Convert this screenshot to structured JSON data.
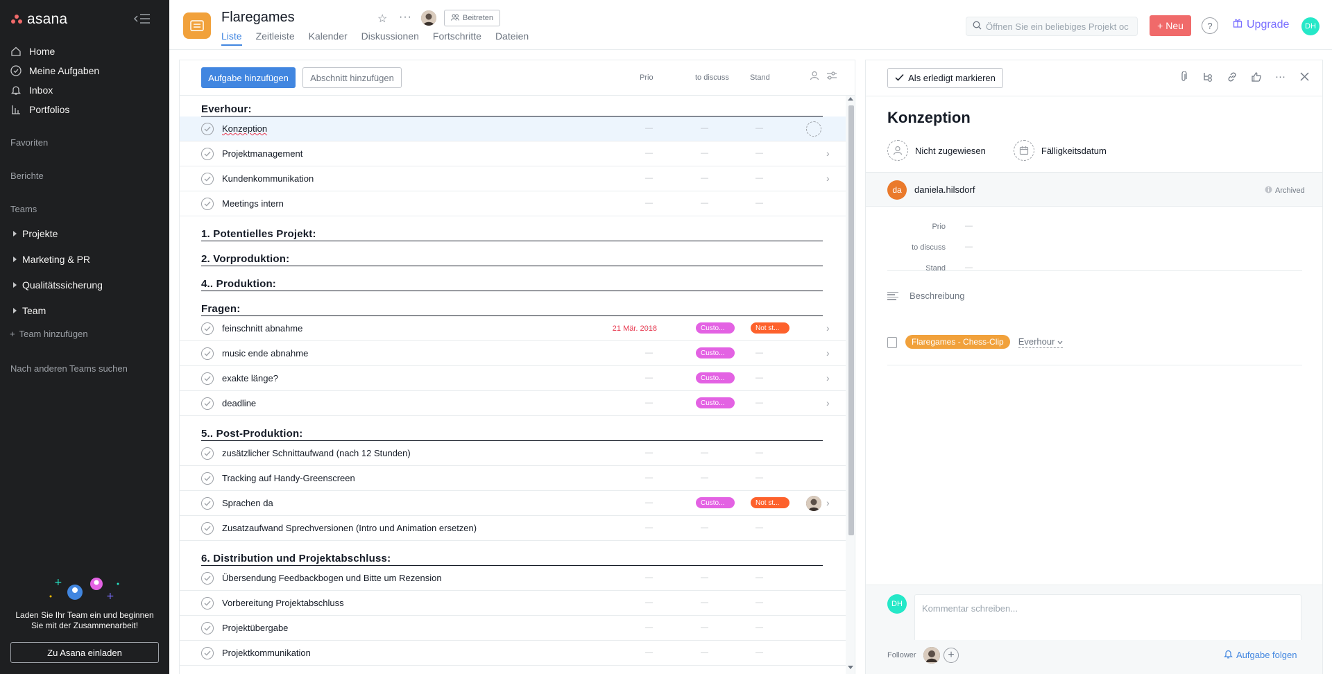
{
  "sidebar": {
    "brand": "asana",
    "nav": [
      {
        "label": "Home",
        "icon": "home-icon"
      },
      {
        "label": "Meine Aufgaben",
        "icon": "check-circle-icon"
      },
      {
        "label": "Inbox",
        "icon": "bell-icon"
      },
      {
        "label": "Portfolios",
        "icon": "bar-chart-icon"
      }
    ],
    "favorites_label": "Favoriten",
    "reports_label": "Berichte",
    "teams_label": "Teams",
    "teams": [
      "Projekte",
      "Marketing & PR",
      "Qualitätssicherung",
      "Team"
    ],
    "add_team": "Team hinzufügen",
    "browse_teams": "Nach anderen Teams suchen",
    "invite_text": "Laden Sie Ihr Team ein und beginnen Sie mit der Zusammenarbeit!",
    "invite_button": "Zu Asana einladen"
  },
  "header": {
    "project_title": "Flaregames",
    "join_button": "Beitreten",
    "tabs": [
      "Liste",
      "Zeitleiste",
      "Kalender",
      "Diskussionen",
      "Fortschritte",
      "Dateien"
    ],
    "active_tab": "Liste",
    "search_placeholder": "Öffnen Sie ein beliebiges Projekt oc",
    "new_button": "Neu",
    "help": "?",
    "upgrade": "Upgrade",
    "user_initials": "DH"
  },
  "list": {
    "add_task_button": "Aufgabe hinzufügen",
    "add_section_button": "Abschnitt hinzufügen",
    "columns": [
      "Prio",
      "to discuss",
      "Stand"
    ],
    "empty": "—",
    "rows": [
      {
        "type": "section",
        "title": "Everhour:"
      },
      {
        "type": "task",
        "name": "Konzeption",
        "highlight": true,
        "assign": true
      },
      {
        "type": "task",
        "name": "Projektmanagement",
        "chevron": true
      },
      {
        "type": "task",
        "name": "Kundenkommunikation",
        "chevron": true
      },
      {
        "type": "task",
        "name": "Meetings intern"
      },
      {
        "type": "section",
        "title": "1. Potentielles Projekt:"
      },
      {
        "type": "section",
        "title": "2. Vorproduktion:"
      },
      {
        "type": "section",
        "title": "4.. Produktion:"
      },
      {
        "type": "section",
        "title": "Fragen:"
      },
      {
        "type": "task",
        "name": "feinschnitt abnahme",
        "due": "21 Mär. 2018",
        "discuss": "Custo...",
        "stand": "Not st...",
        "chevron": true
      },
      {
        "type": "task",
        "name": "music ende abnahme",
        "discuss": "Custo...",
        "chevron": true
      },
      {
        "type": "task",
        "name": "exakte länge?",
        "discuss": "Custo...",
        "chevron": true
      },
      {
        "type": "task",
        "name": "deadline",
        "discuss": "Custo...",
        "chevron": true
      },
      {
        "type": "section",
        "title": "5.. Post-Produktion:"
      },
      {
        "type": "task",
        "name": "zusätzlicher Schnittaufwand (nach 12 Stunden)"
      },
      {
        "type": "task",
        "name": "Tracking auf Handy-Greenscreen"
      },
      {
        "type": "task",
        "name": "Sprachen da",
        "discuss": "Custo...",
        "stand": "Not st...",
        "avatar": true,
        "chevron": true
      },
      {
        "type": "task",
        "name": "Zusatzaufwand Sprechversionen (Intro und Animation ersetzen)"
      },
      {
        "type": "section",
        "title": "6. Distribution und Projektabschluss:"
      },
      {
        "type": "task",
        "name": "Übersendung Feedbackbogen und Bitte um Rezension"
      },
      {
        "type": "task",
        "name": "Vorbereitung Projektabschluss"
      },
      {
        "type": "task",
        "name": "Projektübergabe"
      },
      {
        "type": "task",
        "name": "Projektkommunikation"
      }
    ]
  },
  "detail": {
    "mark_done": "Als erledigt markieren",
    "title": "Konzeption",
    "assignee": "Nicht zugewiesen",
    "due_date": "Fälligkeitsdatum",
    "user_initials": "da",
    "user_name": "daniela.hilsdorf",
    "archived": "Archived",
    "fields": [
      {
        "label": "Prio",
        "value": "—"
      },
      {
        "label": "to discuss",
        "value": "—"
      },
      {
        "label": "Stand",
        "value": "—"
      }
    ],
    "description_placeholder": "Beschreibung",
    "project_tag": "Flaregames - Chess-Clip",
    "section": "Everhour",
    "comment_initials": "DH",
    "comment_placeholder": "Kommentar schreiben...",
    "follower_label": "Follower",
    "follow_button": "Aufgabe folgen"
  },
  "colors": {
    "sidebar_bg": "#1e1f21",
    "primary_blue": "#4186e0",
    "new_button": "#f06a6a",
    "project_orange": "#f1a13b",
    "pill_custom": "#e362e3",
    "pill_notstarted": "#fd612c",
    "overdue": "#e8384f",
    "upgrade_purple": "#796eff"
  }
}
